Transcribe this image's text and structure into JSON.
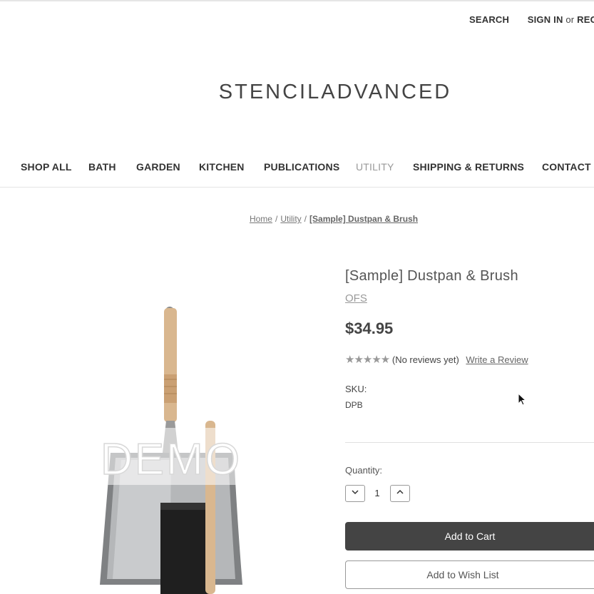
{
  "header": {
    "search_label": "SEARCH",
    "signin_label": "SIGN IN",
    "or_label": "or",
    "register_label": "REGIS",
    "logo": "STENCILADVANCED"
  },
  "nav": {
    "items": [
      {
        "label": "SHOP ALL"
      },
      {
        "label": "BATH"
      },
      {
        "label": "GARDEN"
      },
      {
        "label": "KITCHEN"
      },
      {
        "label": "PUBLICATIONS"
      },
      {
        "label": "UTILITY"
      },
      {
        "label": "SHIPPING & RETURNS"
      },
      {
        "label": "CONTACT U"
      }
    ],
    "active": "UTILITY"
  },
  "breadcrumb": {
    "items": [
      "Home",
      "Utility",
      "[Sample] Dustpan & Brush"
    ],
    "separator": "/"
  },
  "product": {
    "title": "[Sample] Dustpan & Brush",
    "brand": "OFS",
    "price": "$34.95",
    "rating_value": 0,
    "rating_max": 5,
    "stars": "★★★★★",
    "reviews_text": "(No reviews yet)",
    "write_review": "Write a Review",
    "sku_label": "SKU:",
    "sku_value": "DPB",
    "image_watermark": "DEMO"
  },
  "purchase": {
    "quantity_label": "Quantity:",
    "quantity_value": "1",
    "add_to_cart": "Add to Cart",
    "add_to_wishlist": "Add to Wish List"
  },
  "colors": {
    "accent_dark": "#444444",
    "nav_active": "#999999",
    "divider": "#e5e5e5"
  }
}
